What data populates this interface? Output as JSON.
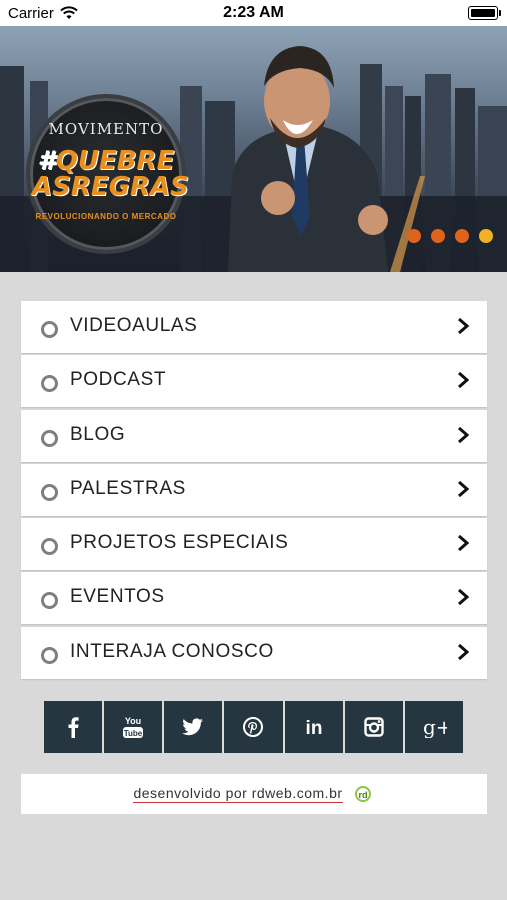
{
  "status_bar": {
    "carrier": "Carrier",
    "time": "2:23 AM"
  },
  "banner": {
    "logo_top": "MOVIMENTO",
    "logo_hash": "#",
    "logo_line1": "QUEBRE",
    "logo_line2": "ASREGRAS",
    "logo_sub": "REVOLUCIONANDO O MERCADO",
    "slide_count": 4,
    "active_slide": 4
  },
  "menu": {
    "items": [
      {
        "label": "VIDEOAULAS"
      },
      {
        "label": "PODCAST"
      },
      {
        "label": "BLOG"
      },
      {
        "label": "PALESTRAS"
      },
      {
        "label": "PROJETOS ESPECIAIS"
      },
      {
        "label": "EVENTOS"
      },
      {
        "label": "INTERAJA CONOSCO"
      }
    ]
  },
  "social": {
    "items": [
      "facebook",
      "youtube",
      "twitter",
      "pinterest",
      "linkedin",
      "instagram",
      "google-plus"
    ],
    "youtube_text": "You Tube",
    "linkedin_text": "in",
    "gplus_text": "g+"
  },
  "footer": {
    "text": "desenvolvido por rdweb.com.br"
  },
  "colors": {
    "background": "#d9d9d9",
    "social_bg": "#263640",
    "dot_inactive": "#e0631c",
    "dot_active": "#f0b125",
    "logo_orange": "#e8901f"
  }
}
